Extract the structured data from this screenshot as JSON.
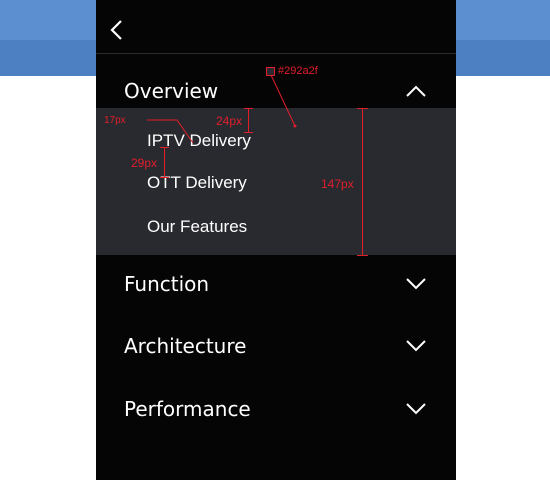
{
  "menu": {
    "items": [
      {
        "label": "Overview",
        "expanded": true
      },
      {
        "label": "Function",
        "expanded": false
      },
      {
        "label": "Architecture",
        "expanded": false
      },
      {
        "label": "Performance",
        "expanded": false
      }
    ],
    "submenu": {
      "items": [
        {
          "label": "IPTV Delivery"
        },
        {
          "label": "OTT Delivery"
        },
        {
          "label": "Our Features"
        }
      ],
      "background": "#292a2f"
    }
  },
  "annotations": {
    "color_label": "#292a2f",
    "font_size_label": "17px",
    "gap_label": "24px",
    "spacing_label": "29px",
    "height_label": "147px"
  },
  "icons": {
    "back": "back-chevron-icon",
    "collapse": "chevron-up-icon",
    "expand": "chevron-down-icon"
  },
  "colors": {
    "panel_bg": "#050505",
    "annotation": "#e21e2b",
    "text": "#ffffff"
  }
}
